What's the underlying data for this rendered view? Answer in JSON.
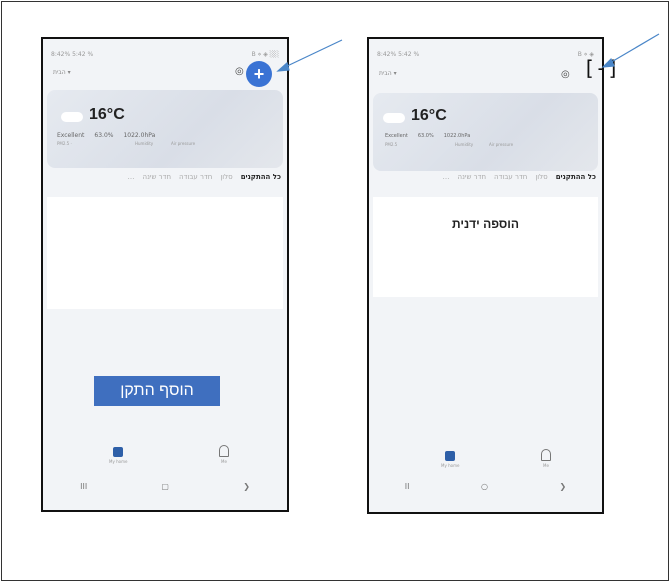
{
  "phone_left": {
    "status_left": "8:42% 5:42 %",
    "status_right": "B ⋄ ◈ ░░",
    "home_name": "הבית ▾",
    "weather": {
      "temperature": "16°C",
      "quality": "Excellent",
      "humidity": "63.0%",
      "pressure": "1022.0hPa",
      "quality_sub": "PM2.5 · ",
      "humidity_sub": "Humidity",
      "pressure_sub": "Air pressure"
    },
    "tabs": [
      "כל ההתקנים",
      "סלון",
      "חדר עבודה",
      "חדר שינה",
      "…"
    ],
    "add_device_label": "הוסף התקן",
    "nav": {
      "home_label": "My home",
      "profile_label": "Me"
    },
    "sysnav": [
      "III",
      "▢",
      "❯"
    ]
  },
  "phone_right": {
    "status_left": "8:42% 5:42 %",
    "status_right": "B ⋄ ◈",
    "home_name": "הבית ▾",
    "weather": {
      "temperature": "16°C",
      "quality": "Excellent",
      "humidity": "63.0%",
      "pressure": "1022.0hPa",
      "quality_sub": "PM2.5",
      "humidity_sub": "Humidity",
      "pressure_sub": "Air pressure"
    },
    "tabs": [
      "כל ההתקנים",
      "סלון",
      "חדר עבודה",
      "חדר שינה",
      "…"
    ],
    "manual_add_label": "הוספה ידנית",
    "nav": {
      "home_label": "My home",
      "profile_label": "Me"
    },
    "sysnav": [
      "II",
      "○",
      "❯"
    ]
  },
  "plus_icon_glyph": "+",
  "bracket_icon_glyph": "[-]",
  "colors": {
    "accent": "#3a73d4",
    "button": "#3f6fbf",
    "arrow": "#4a86c8"
  }
}
